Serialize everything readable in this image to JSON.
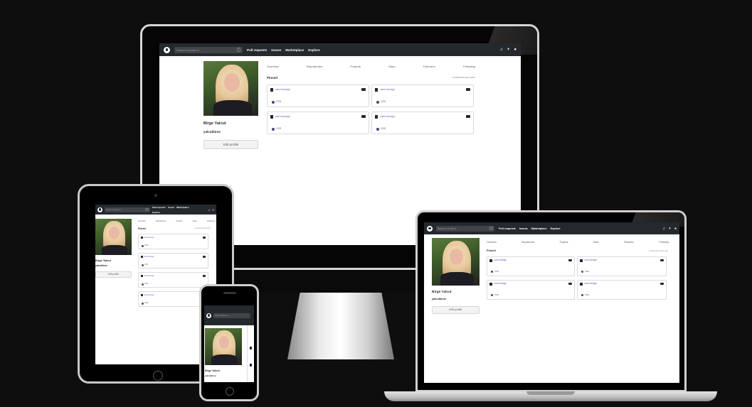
{
  "nav": {
    "search_placeholder": "Search or jump to...",
    "slash_key": "/",
    "links": [
      "Pull requests",
      "Issues",
      "Marketplace",
      "Explore"
    ]
  },
  "profile": {
    "name": "Birge Yalcut",
    "username": "yalcutbirse",
    "edit_label": "Edit profile"
  },
  "tabs": [
    "Overview",
    "Repositories",
    "Projects",
    "Stars",
    "Followers",
    "Following"
  ],
  "pinned": {
    "heading": "Pinned",
    "customize": "Customize your pins",
    "cards": [
      {
        "name": "card-design",
        "language": "CSS"
      },
      {
        "name": "card-design",
        "language": "CSS"
      },
      {
        "name": "card-design",
        "language": "CSS"
      },
      {
        "name": "card-design",
        "language": "CSS"
      }
    ]
  },
  "colors": {
    "nav_bg": "#24292e",
    "link_purple": "#6a5fc4",
    "css_dot": "#563d7c",
    "backdrop": "#0f0e0e"
  }
}
